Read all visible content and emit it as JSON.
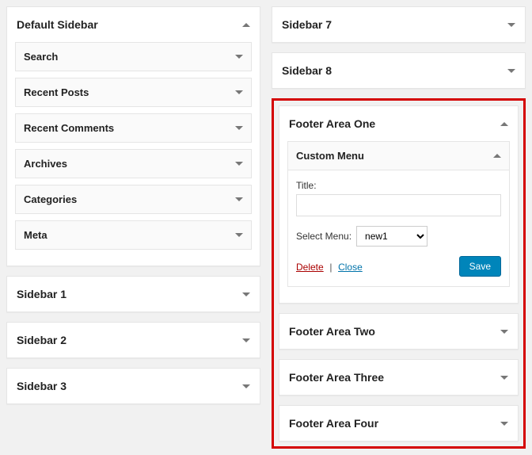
{
  "left": {
    "default_sidebar": {
      "title": "Default Sidebar",
      "widgets": [
        "Search",
        "Recent Posts",
        "Recent Comments",
        "Archives",
        "Categories",
        "Meta"
      ]
    },
    "sections": [
      "Sidebar 1",
      "Sidebar 2",
      "Sidebar 3"
    ]
  },
  "right": {
    "top_sections": [
      "Sidebar 7",
      "Sidebar 8"
    ],
    "footer_one": {
      "title": "Footer Area One",
      "widget": {
        "title": "Custom Menu",
        "title_label": "Title:",
        "title_value": "",
        "select_label": "Select Menu:",
        "select_value": "new1",
        "delete": "Delete",
        "close": "Close",
        "save": "Save"
      }
    },
    "other_footers": [
      "Footer Area Two",
      "Footer Area Three",
      "Footer Area Four"
    ]
  }
}
